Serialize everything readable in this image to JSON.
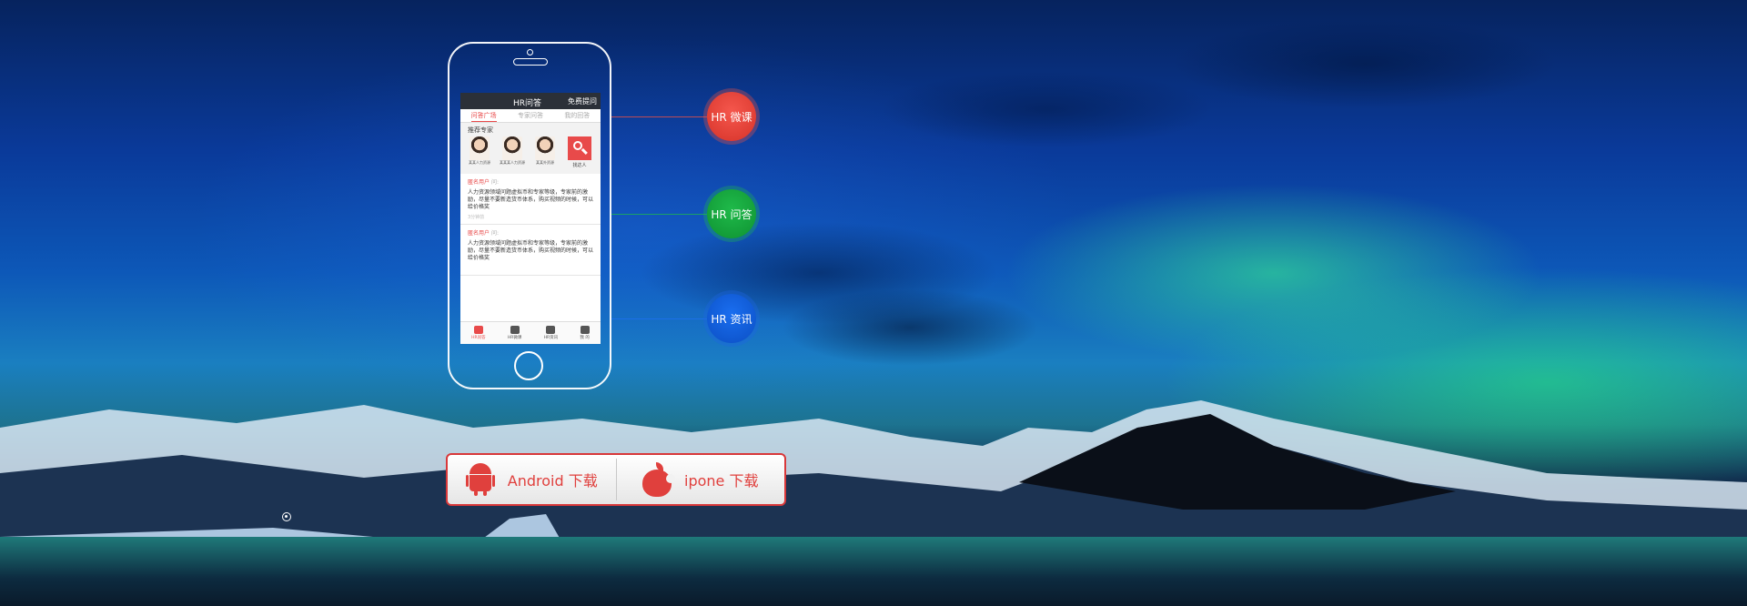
{
  "phone": {
    "header_title": "HR问答",
    "header_action": "免费提问",
    "tabs": [
      "问答广场",
      "专家问答",
      "我的回答"
    ],
    "experts_label": "推荐专家",
    "experts": [
      "某某人力资源",
      "某某某人力资源",
      "某某外资源"
    ],
    "search_label": "找达人",
    "posts": [
      {
        "user": "匿名用户",
        "action": "问:",
        "content": "人力资源领域问题虚拟币和专家等级，专家前的激励，尽量不要新造货币体系，购买视频的时候，可以给价格奖",
        "meta": "3分钟前"
      },
      {
        "user": "匿名用户",
        "action": "问:",
        "content": "人力资源领域问题虚拟币和专家等级，专家前的激励，尽量不要新造货币体系，购买视频的时候，可以给价格奖",
        "meta": ""
      }
    ],
    "nav": [
      "HR问答",
      "HR微课",
      "HR资讯",
      "我 的"
    ]
  },
  "features": {
    "weike": "HR 微课",
    "wenda": "HR 问答",
    "zixun": "HR 资讯"
  },
  "downloads": {
    "android": "Android 下载",
    "ios": "ipone 下载"
  },
  "colors": {
    "red": "#e84a4a",
    "green": "#1fba4a",
    "blue": "#1a6ef0"
  }
}
